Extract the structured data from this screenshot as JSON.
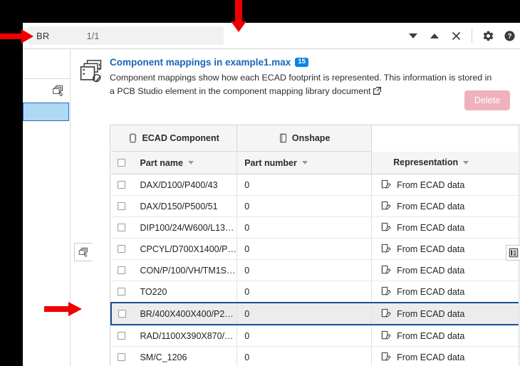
{
  "find_bar": {
    "query": "BR",
    "match_count": "1/1",
    "prev_icon": "chevron-down-icon",
    "next_icon": "chevron-up-icon",
    "close_icon": "close-icon",
    "settings_icon": "gear-icon",
    "help_icon": "help-icon"
  },
  "header": {
    "icon": "component-mapping-icon",
    "title": "Component mappings in example1.max",
    "badge": "15",
    "description": "Component mappings show how each ECAD footprint is represented. This information is stored in a PCB Studio element in the component mapping library document",
    "external_link_icon": "external-link-icon",
    "delete_label": "Delete"
  },
  "table": {
    "group_headers": [
      {
        "label": "ECAD Component",
        "icon": "chip-icon",
        "colspan": 2
      },
      {
        "label": "Onshape",
        "icon": "part-icon",
        "colspan": 1
      }
    ],
    "columns": [
      {
        "label": "",
        "type": "checkbox"
      },
      {
        "label": "Part name",
        "sortable": true
      },
      {
        "label": "Part number",
        "sortable": true
      },
      {
        "label": "Representation",
        "sortable": true
      }
    ],
    "rows": [
      {
        "part_name": "DAX/D100/P400/43",
        "part_number": "0",
        "representation": "From ECAD data",
        "selected": false
      },
      {
        "part_name": "DAX/D150/P500/51",
        "part_number": "0",
        "representation": "From ECAD data",
        "selected": false
      },
      {
        "part_name": "DIP100/24/W600/L13…",
        "part_number": "0",
        "representation": "From ECAD data",
        "selected": false
      },
      {
        "part_name": "CPCYL/D700X1400/P…",
        "part_number": "0",
        "representation": "From ECAD data",
        "selected": false
      },
      {
        "part_name": "CON/P/100/VH/TM1S…",
        "part_number": "0",
        "representation": "From ECAD data",
        "selected": false
      },
      {
        "part_name": "TO220",
        "part_number": "0",
        "representation": "From ECAD data",
        "selected": false
      },
      {
        "part_name": "BR/400X400X400/P2…",
        "part_number": "0",
        "representation": "From ECAD data",
        "selected": true
      },
      {
        "part_name": "RAD/1100X390X870/…",
        "part_number": "0",
        "representation": "From ECAD data",
        "selected": false
      },
      {
        "part_name": "SM/C_1206",
        "part_number": "0",
        "representation": "From ECAD data",
        "selected": false
      }
    ],
    "representation_icon": "ecad-data-icon",
    "row_checkbox_icon": "checkbox-icon"
  },
  "overlays": {
    "left_panel_icon": "layers-icon",
    "right_panel_icon": "list-panel-icon",
    "sidebar_icon": "layers-edit-icon"
  },
  "colors": {
    "accent_blue": "#1b65b8",
    "badge_blue": "#0b84e6",
    "selection_border": "#1c4e9c",
    "sidebar_selected": "#aed8f4",
    "delete_disabled": "#efb2bc",
    "annotation_red": "#ef0000"
  }
}
